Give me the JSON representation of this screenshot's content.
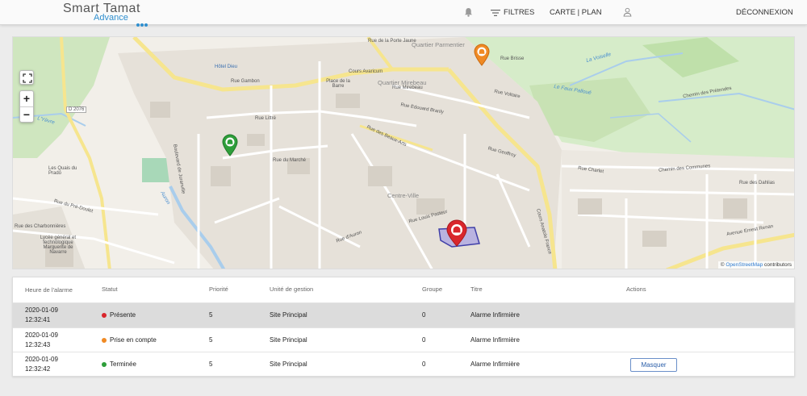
{
  "header": {
    "logo_main": "Smart Tamat",
    "logo_sub": "Advance",
    "filters_label": "FILTRES",
    "map_label": "CARTE | PLAN",
    "logout_label": "DÉCONNEXION"
  },
  "map": {
    "zoom_in": "+",
    "zoom_out": "−",
    "attribution_prefix": "© ",
    "attribution_link": "OpenStreetMap",
    "attribution_suffix": " contributors",
    "labels": {
      "quartier_parmentier": "Quartier Parmentier",
      "quartier_mirebeau": "Quartier Mirebeau",
      "centre_ville": "Centre-Ville",
      "hotel_dieu": "Hôtel Dieu",
      "place_barre": "Place de la Barre",
      "quais_prado": "Les Quais du Prado",
      "lycee": "Lycée général et technologique Marguerite de Navarre",
      "d2076": "D 2076",
      "yevre": "L'Yèvre",
      "auron": "Auron",
      "voiselle": "La Voiselle",
      "faux_palloue": "Le Faux Palloué",
      "avenue_renan": "Avenue Ernest Renan",
      "rue_gambon": "Rue Gambon",
      "rue_littre": "Rue Littré",
      "rue_marche": "Rue du Marché",
      "rue_beaux_arts": "Rue des Beaux-Arts",
      "rue_edouard_branly": "Rue Edouard Branly",
      "rue_voltaire": "Rue Voltaire",
      "rue_geoffroy": "Rue Geoffroy",
      "rue_charlet": "Rue Charlet",
      "rue_dahlias": "Rue des Dahlias",
      "cours_avaricum": "Cours Avaricum",
      "chemin_communes": "Chemin des Communes",
      "rue_louis_pasteur": "Rue Louis Pasteur",
      "rue_auron": "Rue d'Auron",
      "boulevard_juranville": "Boulevard de Juranville",
      "rue_pre_doulet": "Rue du Pré-Doulet",
      "rue_charbonnieres": "Rue des Charbonnières",
      "cours_anatole_france": "Cours Anatole France",
      "chemin_pretendes": "Chemin des Prétendes",
      "rue_mirebeau": "Rue Mirebeau",
      "rue_brisse": "Rue Brisse",
      "rue_porte_jaune": "Rue de la Porte Jaune"
    }
  },
  "table": {
    "headers": {
      "time": "Heure de l'alarme",
      "status": "Statut",
      "priority": "Priorité",
      "unit": "Unité de gestion",
      "group": "Groupe",
      "title": "Titre",
      "actions": "Actions"
    },
    "rows": [
      {
        "date": "2020-01-09",
        "time": "12:32:41",
        "status": "Présente",
        "status_color": "#d9262c",
        "priority": "5",
        "unit": "Site Principal",
        "group": "0",
        "title": "Alarme Infirmière"
      },
      {
        "date": "2020-01-09",
        "time": "12:32:43",
        "status": "Prise en compte",
        "status_color": "#f08a24",
        "priority": "5",
        "unit": "Site Principal",
        "group": "0",
        "title": "Alarme Infirmière"
      },
      {
        "date": "2020-01-09",
        "time": "12:32:42",
        "status": "Terminée",
        "status_color": "#2e9e3a",
        "priority": "5",
        "unit": "Site Principal",
        "group": "0",
        "title": "Alarme Infirmière",
        "action_label": "Masquer"
      }
    ]
  },
  "colors": {
    "accent": "#2f8fcf",
    "selected_row": "#dcdcdc",
    "pin_red": "#d9262c",
    "pin_orange": "#f08a24",
    "pin_green": "#2e9e3a"
  }
}
